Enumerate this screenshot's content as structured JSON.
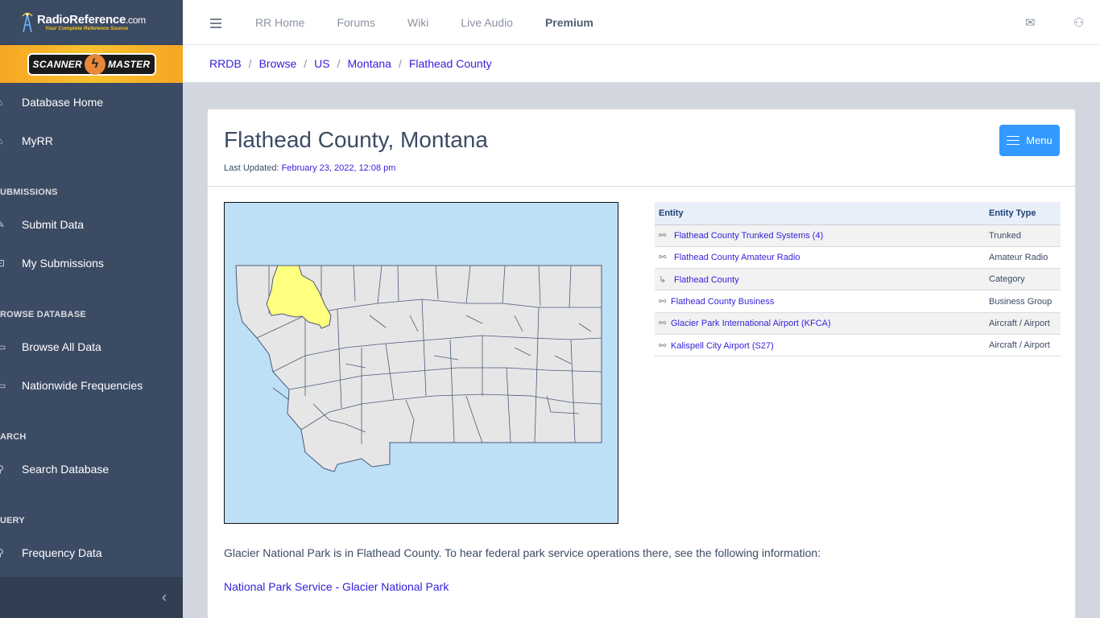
{
  "brand": {
    "logo_main": "RadioReference",
    "logo_suffix": ".com",
    "tagline": "Your Complete Reference Source",
    "sponsor_left": "SCANNER",
    "sponsor_right": "MASTER"
  },
  "sidebar": {
    "items": [
      {
        "type": "item",
        "label": "Database Home",
        "icon": "home-icon",
        "glyph": "⌂"
      },
      {
        "type": "item",
        "label": "MyRR",
        "icon": "home-icon",
        "glyph": "⌂"
      },
      {
        "type": "title",
        "label": "UBMISSIONS"
      },
      {
        "type": "item",
        "label": "Submit Data",
        "icon": "pencil-icon",
        "glyph": "✎"
      },
      {
        "type": "item",
        "label": "My Submissions",
        "icon": "basket-icon",
        "glyph": "⊡"
      },
      {
        "type": "title",
        "label": "ROWSE DATABASE"
      },
      {
        "type": "item",
        "label": "Browse All Data",
        "icon": "monitor-icon",
        "glyph": "▭"
      },
      {
        "type": "item",
        "label": "Nationwide Frequencies",
        "icon": "monitor-icon",
        "glyph": "▭"
      },
      {
        "type": "title",
        "label": "ARCH"
      },
      {
        "type": "item",
        "label": "Search Database",
        "icon": "search-icon",
        "glyph": "⚲"
      },
      {
        "type": "title",
        "label": "UERY"
      },
      {
        "type": "item",
        "label": "Frequency Data",
        "icon": "search-icon",
        "glyph": "⚲"
      }
    ],
    "collapse_glyph": "‹"
  },
  "topnav": {
    "links": [
      "RR Home",
      "Forums",
      "Wiki",
      "Live Audio"
    ],
    "premium": "Premium"
  },
  "breadcrumb": [
    "RRDB",
    "Browse",
    "US",
    "Montana",
    "Flathead County"
  ],
  "page": {
    "title": "Flathead County, Montana",
    "updated_label": "Last Updated:",
    "updated_value": "February 23, 2022, 12:08 pm",
    "menu_label": "Menu"
  },
  "table": {
    "headers": [
      "Entity",
      "Entity Type"
    ],
    "rows": [
      {
        "entity": "Flathead County Trunked Systems (4)",
        "type": "Trunked",
        "icon": "paperclip-icon",
        "glyph": "⚯",
        "indent": true
      },
      {
        "entity": "Flathead County Amateur Radio",
        "type": "Amateur Radio",
        "icon": "paperclip-icon",
        "glyph": "⚯",
        "indent": true
      },
      {
        "entity": "Flathead County",
        "type": "Category",
        "icon": "subdirectory-icon",
        "glyph": "↳",
        "indent": true
      },
      {
        "entity": "Flathead County Business",
        "type": "Business Group",
        "icon": "paperclip-icon",
        "glyph": "⚯",
        "indent": false
      },
      {
        "entity": "Glacier Park International Airport (KFCA)",
        "type": "Aircraft / Airport",
        "icon": "paperclip-icon",
        "glyph": "⚯",
        "indent": false
      },
      {
        "entity": "Kalispell City Airport (S27)",
        "type": "Aircraft / Airport",
        "icon": "paperclip-icon",
        "glyph": "⚯",
        "indent": false
      }
    ]
  },
  "content": {
    "description": "Glacier National Park is in Flathead County. To hear federal park service operations there, see the following information:",
    "link": "National Park Service - Glacier National Park"
  },
  "map": {
    "water_color": "#bde0f6",
    "state_color": "#e6e6e6",
    "highlight_color": "#ffff80",
    "border_color": "#4a5a7a"
  }
}
